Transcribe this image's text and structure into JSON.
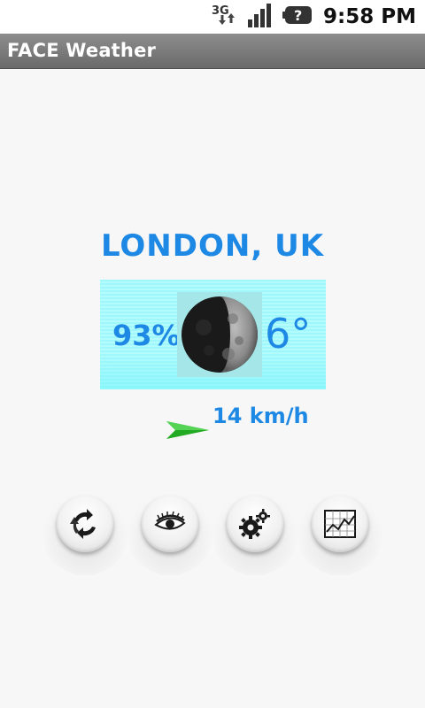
{
  "status_bar": {
    "time": "9:58 PM",
    "network_label": "3G",
    "icons": [
      "3g-data-icon",
      "signal-bars-icon",
      "battery-unknown-icon"
    ]
  },
  "app": {
    "title": "FACE Weather"
  },
  "weather": {
    "location": "LONDON, UK",
    "humidity": "93%",
    "temperature": "6°",
    "condition_icon": "moon-phase-icon",
    "wind_speed": "14 km/h",
    "wind_icon": "green-wind-arrow-icon"
  },
  "actions": [
    {
      "name": "refresh",
      "icon": "refresh-arrows-icon"
    },
    {
      "name": "view",
      "icon": "eye-icon"
    },
    {
      "name": "settings",
      "icon": "gears-icon"
    },
    {
      "name": "chart",
      "icon": "line-chart-icon"
    }
  ],
  "colors": {
    "accent_blue": "#1e88e5",
    "panel_cyan": "#9ef7fb",
    "title_bar": "#7a7a7a",
    "wind_green": "#22aa22"
  }
}
